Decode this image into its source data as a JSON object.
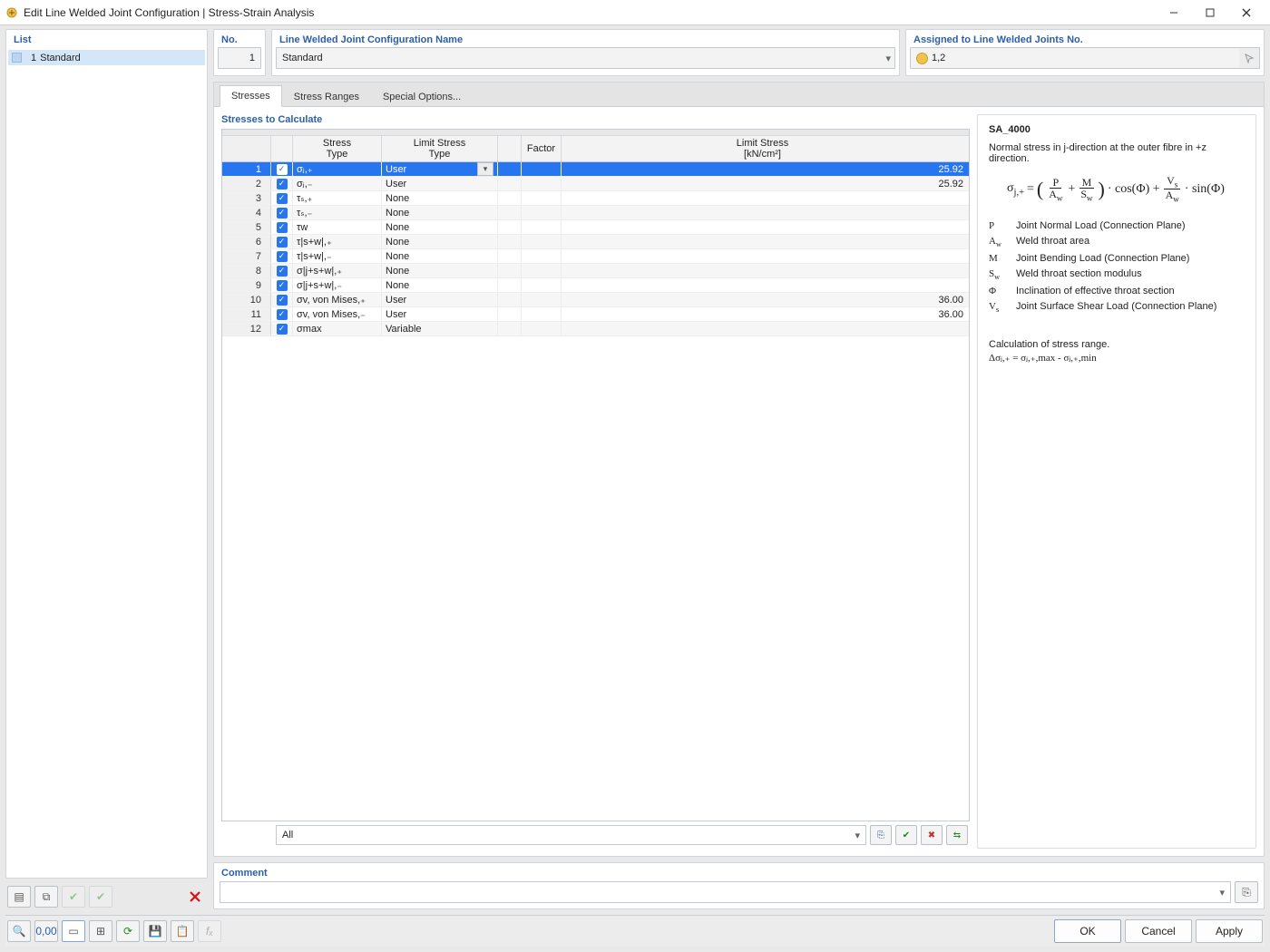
{
  "window": {
    "title": "Edit Line Welded Joint Configuration | Stress-Strain Analysis"
  },
  "left": {
    "panel_title": "List",
    "items": [
      {
        "num": "1",
        "name": "Standard"
      }
    ]
  },
  "header": {
    "no_label": "No.",
    "no_value": "1",
    "name_label": "Line Welded Joint Configuration Name",
    "name_value": "Standard",
    "assigned_label": "Assigned to Line Welded Joints No.",
    "assigned_value": "1,2"
  },
  "tabs": {
    "items": [
      "Stresses",
      "Stress Ranges",
      "Special Options..."
    ],
    "active": 0
  },
  "grid": {
    "section_title": "Stresses to Calculate",
    "headers": {
      "stress_type": "Stress\nType",
      "limit_type": "Limit Stress\nType",
      "factor": "Factor",
      "limit_stress": "Limit Stress\n[kN/cm²]"
    },
    "rows": [
      {
        "n": 1,
        "chk": true,
        "st": "σⱼ,₊",
        "lt": "User",
        "sp": "",
        "f": "",
        "ls": "25.92",
        "sel": true
      },
      {
        "n": 2,
        "chk": true,
        "st": "σⱼ,₋",
        "lt": "User",
        "sp": "",
        "f": "",
        "ls": "25.92"
      },
      {
        "n": 3,
        "chk": true,
        "st": "τₛ,₊",
        "lt": "None",
        "sp": "",
        "f": "",
        "ls": ""
      },
      {
        "n": 4,
        "chk": true,
        "st": "τₛ,₋",
        "lt": "None",
        "sp": "",
        "f": "",
        "ls": ""
      },
      {
        "n": 5,
        "chk": true,
        "st": "τw",
        "lt": "None",
        "sp": "",
        "f": "",
        "ls": ""
      },
      {
        "n": 6,
        "chk": true,
        "st": "τ|s+w|,₊",
        "lt": "None",
        "sp": "",
        "f": "",
        "ls": ""
      },
      {
        "n": 7,
        "chk": true,
        "st": "τ|s+w|,₋",
        "lt": "None",
        "sp": "",
        "f": "",
        "ls": ""
      },
      {
        "n": 8,
        "chk": true,
        "st": "σ|j+s+w|,₊",
        "lt": "None",
        "sp": "",
        "f": "",
        "ls": ""
      },
      {
        "n": 9,
        "chk": true,
        "st": "σ|j+s+w|,₋",
        "lt": "None",
        "sp": "",
        "f": "",
        "ls": ""
      },
      {
        "n": 10,
        "chk": true,
        "st": "σv, von Mises,₊",
        "lt": "User",
        "sp": "",
        "f": "",
        "ls": "36.00"
      },
      {
        "n": 11,
        "chk": true,
        "st": "σv, von Mises,₋",
        "lt": "User",
        "sp": "",
        "f": "",
        "ls": "36.00"
      },
      {
        "n": 12,
        "chk": true,
        "st": "σmax",
        "lt": "Variable",
        "sp": "",
        "f": "",
        "ls": ""
      }
    ],
    "footer_filter": "All"
  },
  "info": {
    "title": "SA_4000",
    "desc": "Normal stress in j-direction at the outer fibre in +z direction.",
    "legend": [
      {
        "sym": "P",
        "txt": "Joint Normal Load (Connection Plane)"
      },
      {
        "sym": "A_w",
        "txt": "Weld throat area"
      },
      {
        "sym": "M",
        "txt": "Joint Bending Load (Connection Plane)"
      },
      {
        "sym": "S_w",
        "txt": "Weld throat section modulus"
      },
      {
        "sym": "Φ",
        "txt": "Inclination of effective throat section"
      },
      {
        "sym": "V_s",
        "txt": "Joint Surface Shear Load (Connection Plane)"
      }
    ],
    "calc_note": "Calculation of stress range.",
    "calc_eq": "Δσⱼ,₊ = σⱼ,₊,max - σⱼ,₊,min"
  },
  "comment": {
    "label": "Comment",
    "value": ""
  },
  "buttons": {
    "ok": "OK",
    "cancel": "Cancel",
    "apply": "Apply"
  }
}
